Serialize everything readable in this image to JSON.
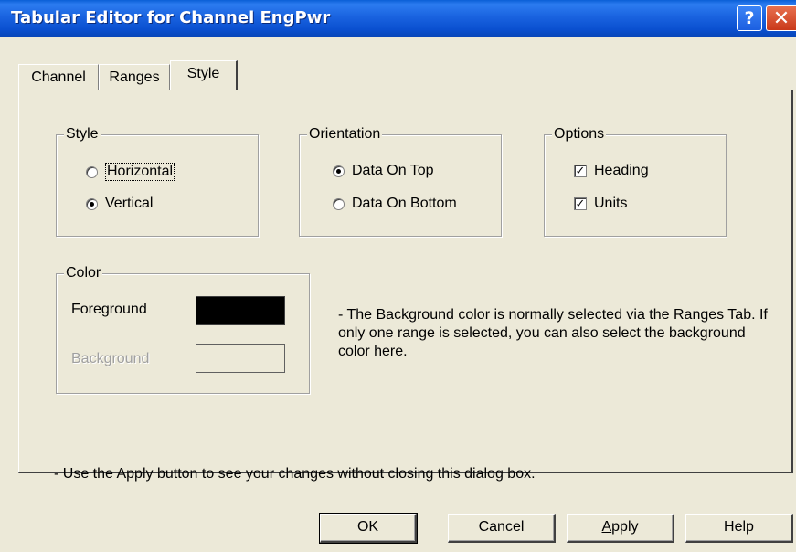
{
  "window": {
    "title": "Tabular Editor for Channel EngPwr",
    "help_glyph": "?",
    "close_glyph": "✕"
  },
  "tabs": [
    {
      "label": "Channel",
      "active": false
    },
    {
      "label": "Ranges",
      "active": false
    },
    {
      "label": "Style",
      "active": true
    }
  ],
  "style_group": {
    "title": "Style",
    "options": [
      {
        "label": "Horizontal",
        "checked": false
      },
      {
        "label": "Vertical",
        "checked": true
      }
    ]
  },
  "orientation_group": {
    "title": "Orientation",
    "options": [
      {
        "label": "Data On Top",
        "checked": true
      },
      {
        "label": "Data On Bottom",
        "checked": false
      }
    ]
  },
  "options_group": {
    "title": "Options",
    "items": [
      {
        "label": "Heading",
        "checked": true
      },
      {
        "label": "Units",
        "checked": true
      }
    ]
  },
  "color_group": {
    "title": "Color",
    "foreground_label": "Foreground",
    "foreground_color": "#000000",
    "background_label": "Background",
    "background_color": "#ece9d8"
  },
  "notes": {
    "background_note": "- The Background color is normally selected via the Ranges Tab.  If only one range is selected, you can also select the background color here.",
    "apply_note": "- Use the Apply button to see your changes without closing this dialog box."
  },
  "buttons": {
    "ok": "OK",
    "cancel": "Cancel",
    "apply_mnemonic": "A",
    "apply_rest": "pply",
    "help": "Help"
  },
  "colors": {
    "title_blue": "#0a50d0",
    "dialog_bg": "#ece9d8"
  }
}
